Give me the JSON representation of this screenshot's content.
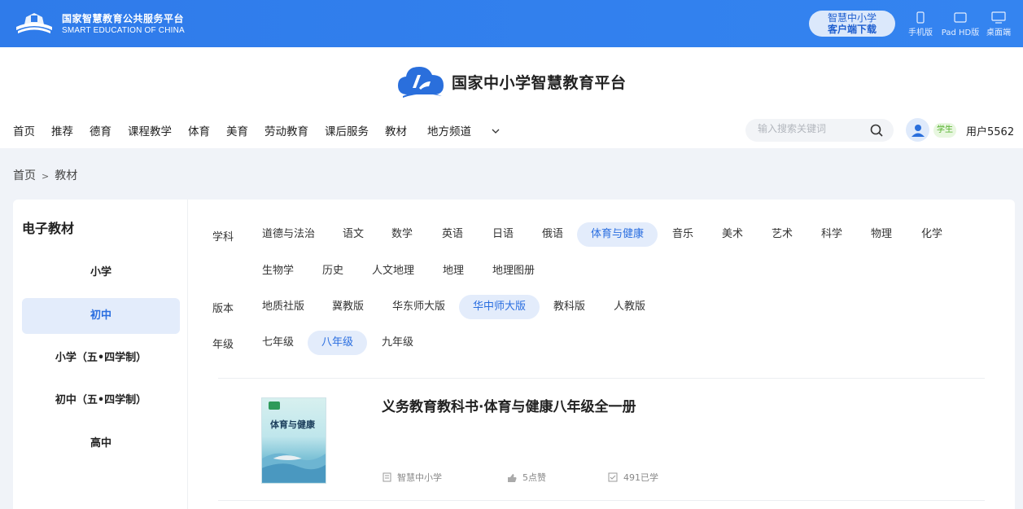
{
  "topbar": {
    "logo_cn": "国家智慧教育公共服务平台",
    "logo_en": "SMART EDUCATION OF CHINA",
    "download_line1": "智慧中小学",
    "download_line2": "客户端下载",
    "devices": [
      {
        "label": "手机版",
        "icon": "phone-icon"
      },
      {
        "label": "Pad HD版",
        "icon": "tablet-icon"
      },
      {
        "label": "桌面端",
        "icon": "desktop-icon"
      }
    ]
  },
  "header": {
    "brand": "国家中小学智慧教育平台",
    "nav": [
      "首页",
      "推荐",
      "德育",
      "课程教学",
      "体育",
      "美育",
      "劳动教育",
      "课后服务",
      "教材",
      "地方频道"
    ],
    "search_placeholder": "输入搜索关键词",
    "role_badge": "学生",
    "username": "用户5562"
  },
  "breadcrumb": {
    "home": "首页",
    "sep": ">",
    "current": "教材"
  },
  "sidebar": {
    "title": "电子教材",
    "items": [
      {
        "label": "小学",
        "active": false
      },
      {
        "label": "初中",
        "active": true
      },
      {
        "label": "小学（五•四学制）",
        "active": false
      },
      {
        "label": "初中（五•四学制）",
        "active": false
      },
      {
        "label": "高中",
        "active": false
      }
    ]
  },
  "filters": {
    "subject_label": "学科",
    "subjects": [
      "道德与法治",
      "语文",
      "数学",
      "英语",
      "日语",
      "俄语",
      "体育与健康",
      "音乐",
      "美术",
      "艺术",
      "科学",
      "物理",
      "化学",
      "生物学",
      "历史",
      "人文地理",
      "地理",
      "地理图册"
    ],
    "subject_active": "体育与健康",
    "edition_label": "版本",
    "editions": [
      "地质社版",
      "冀教版",
      "华东师大版",
      "华中师大版",
      "教科版",
      "人教版"
    ],
    "edition_active": "华中师大版",
    "grade_label": "年级",
    "grades": [
      "七年级",
      "八年级",
      "九年级"
    ],
    "grade_active": "八年级"
  },
  "book": {
    "title": "义务教育教科书·体育与健康八年级全一册",
    "cover_title": "体育与健康",
    "source": "智慧中小学",
    "likes": "5点赞",
    "learned": "491已学"
  },
  "colors": {
    "primary": "#2f80ed",
    "accent": "#2a6ee0",
    "active_bg": "#e3ecfb",
    "role_green": "#52b02a"
  }
}
